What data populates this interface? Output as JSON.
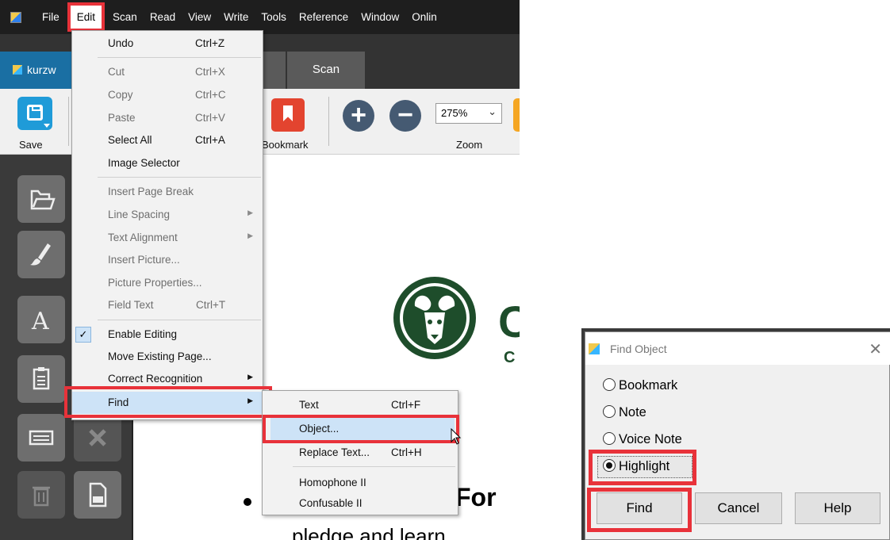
{
  "menubar": {
    "items": [
      "File",
      "Edit",
      "Scan",
      "Read",
      "View",
      "Write",
      "Tools",
      "Reference",
      "Window",
      "Onlin"
    ]
  },
  "tabs": {
    "kurz": "kurzw",
    "scan": "Scan"
  },
  "ribbon": {
    "save_label": "Save",
    "bookmark_label": "Bookmark",
    "zoom_value": "275%",
    "zoom_label": "Zoom"
  },
  "edit_menu": {
    "undo": "Undo",
    "undo_sc": "Ctrl+Z",
    "cut": "Cut",
    "cut_sc": "Ctrl+X",
    "copy": "Copy",
    "copy_sc": "Ctrl+C",
    "paste": "Paste",
    "paste_sc": "Ctrl+V",
    "select_all": "Select All",
    "select_all_sc": "Ctrl+A",
    "image_selector": "Image Selector",
    "insert_page_break": "Insert Page Break",
    "line_spacing": "Line Spacing",
    "text_alignment": "Text Alignment",
    "insert_picture": "Insert Picture...",
    "picture_properties": "Picture Properties...",
    "field_text": "Field Text",
    "field_text_sc": "Ctrl+T",
    "enable_editing": "Enable Editing",
    "move_existing_page": "Move Existing Page...",
    "correct_recognition": "Correct Recognition",
    "find": "Find"
  },
  "find_submenu": {
    "text": "Text",
    "text_sc": "Ctrl+F",
    "object": "Object...",
    "replace_text": "Replace Text...",
    "replace_text_sc": "Ctrl+H",
    "homophone": "Homophone II",
    "confusable": "Confusable II"
  },
  "document": {
    "logo_letter": "C",
    "logo_sub": "C",
    "heading": "For",
    "text": "pledge and learn"
  },
  "dialog": {
    "title": "Find Object",
    "close": "✕",
    "options": [
      "Bookmark",
      "Note",
      "Voice Note",
      "Highlight"
    ],
    "selected": "Highlight",
    "buttons": {
      "find": "Find",
      "cancel": "Cancel",
      "help": "Help"
    }
  },
  "colors": {
    "annotation_red": "#e8323a",
    "menu_highlight": "#cde3f7",
    "csu_green": "#1e4d2b"
  }
}
